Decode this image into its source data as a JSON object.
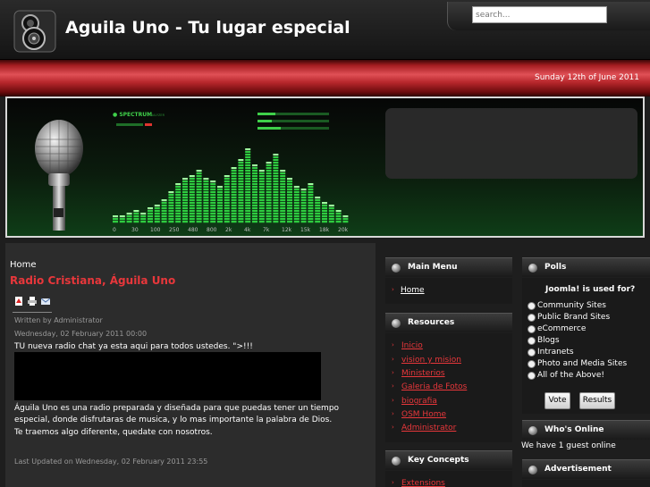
{
  "header": {
    "site_title": "Aguila Uno - Tu lugar especial",
    "search_placeholder": "search..."
  },
  "date": "Sunday 12th of June 2011",
  "banner": {
    "spectrum_logo": "SPECTRUM",
    "spectrum_sub": "ANALYZER",
    "freq_labels": [
      "0",
      "30",
      "100",
      "250",
      "480",
      "800",
      "2k",
      "4k",
      "7k",
      "12k",
      "15k",
      "18k",
      "20k"
    ],
    "bar_levels": [
      0.08,
      0.1,
      0.12,
      0.15,
      0.12,
      0.18,
      0.22,
      0.28,
      0.35,
      0.45,
      0.5,
      0.55,
      0.6,
      0.5,
      0.48,
      0.42,
      0.55,
      0.62,
      0.72,
      0.85,
      0.65,
      0.6,
      0.7,
      0.78,
      0.6,
      0.5,
      0.42,
      0.38,
      0.45,
      0.3,
      0.25,
      0.2,
      0.15,
      0.1
    ]
  },
  "main": {
    "breadcrumb": "Home",
    "article_title": "Radio Cristiana, Águila Uno",
    "author": "Written by Administrator",
    "created": "Wednesday, 02 February 2011 00:00",
    "intro": "TU nueva radio chat ya esta aqui para todos ustedes. \">!!!",
    "desc": "Águila Uno es una radio preparada y diseñada para que puedas tener un tiempo especial, donde disfrutaras de musica, y lo mas importante la palabra de Dios.",
    "desc2": "Te traemos algo diferente, quedate con nosotros.",
    "modified": "Last Updated on Wednesday, 02 February 2011 23:55",
    "icons": [
      "pdf-icon",
      "print-icon",
      "email-icon"
    ]
  },
  "modules": {
    "main_menu": {
      "title": "Main Menu",
      "items": [
        "Home"
      ]
    },
    "resources": {
      "title": "Resources",
      "items": [
        "Inicio",
        "vision y mision",
        "Ministerios",
        "Galeria de Fotos",
        "biografia",
        "OSM Home",
        "Administrator"
      ]
    },
    "key_concepts": {
      "title": "Key Concepts",
      "items": [
        "Extensions"
      ]
    },
    "polls": {
      "title": "Polls",
      "question": "Joomla! is used for?",
      "options": [
        "Community Sites",
        "Public Brand Sites",
        "eCommerce",
        "Blogs",
        "Intranets",
        "Photo and Media Sites",
        "All of the Above!"
      ],
      "vote_label": "Vote",
      "results_label": "Results"
    },
    "whos_online": {
      "title": "Who's Online",
      "text": "We have 1 guest online"
    },
    "advertisement": {
      "title": "Advertisement"
    }
  },
  "colors": {
    "accent": "#e8373b",
    "bar_red": "#b6262b",
    "spectrum_green": "#2ecc40"
  }
}
